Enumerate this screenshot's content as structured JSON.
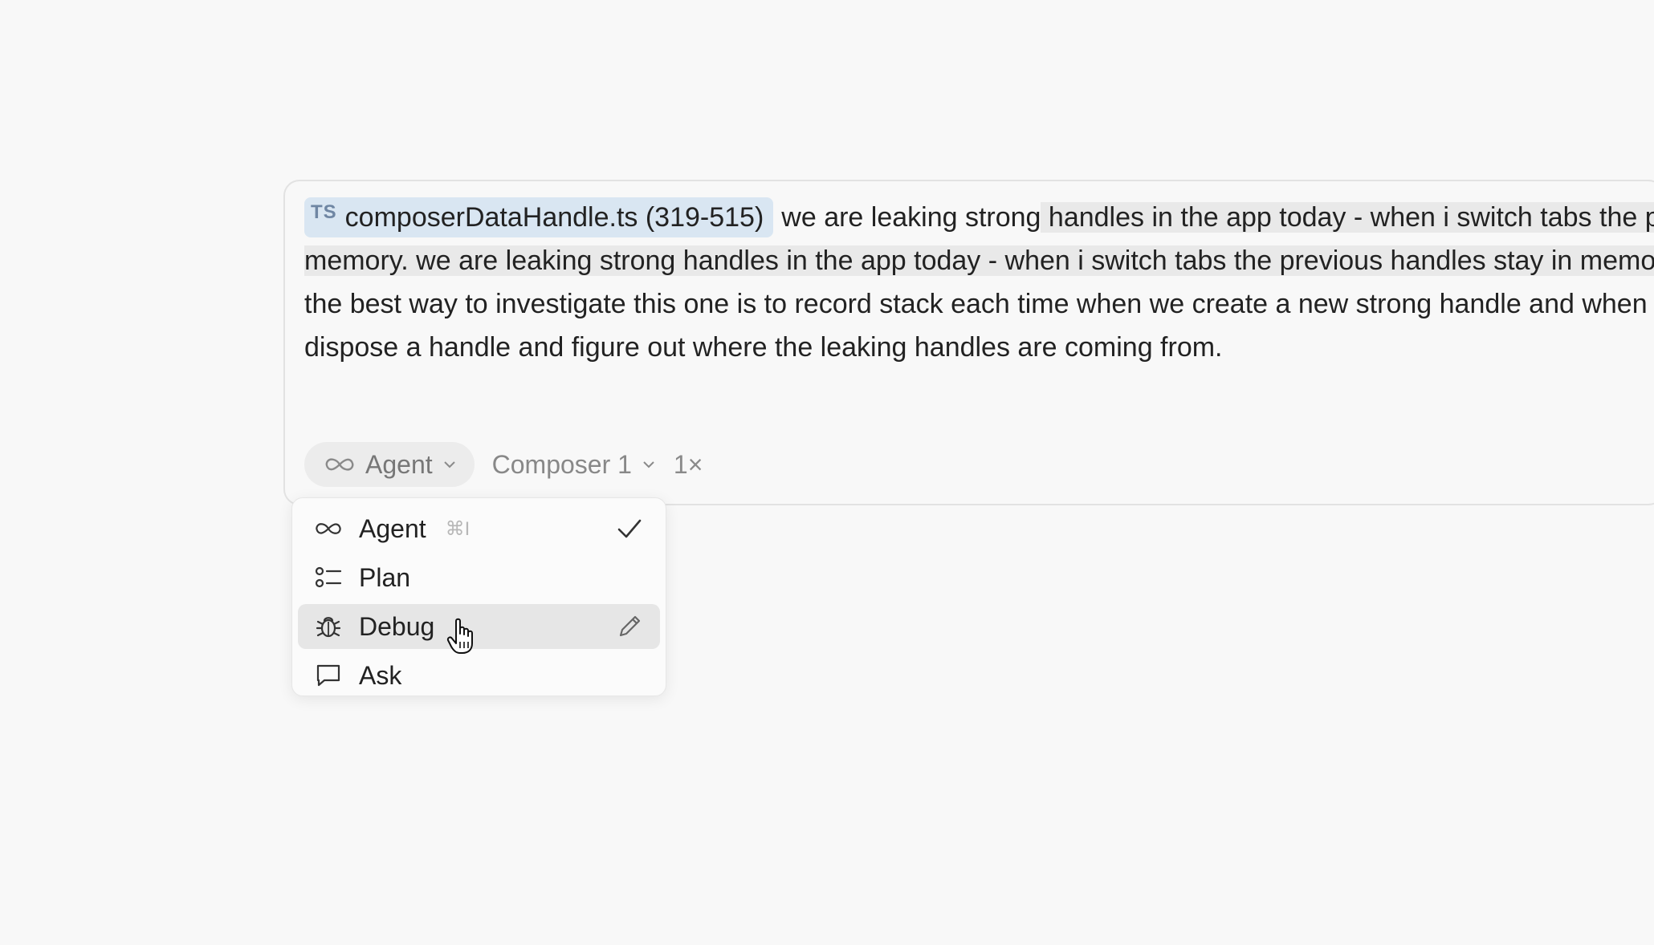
{
  "composer": {
    "file_chip": {
      "lang": "TS",
      "filename": "composerDataHandle.ts (319-515)"
    },
    "line1_pre": "we are leaking strong",
    "line1_hl": " handles in the app today - when i switch tabs the previous handles stay in",
    "line2": "memory. we are leaking strong handles in the app today - when i switch tabs the previous handles stay in memory.",
    "line3": "the best way to investigate this one is to record stack each time when we create a new strong handle and when we",
    "line4": "dispose a handle and figure out where the leaking handles are coming from."
  },
  "toolbar": {
    "mode_label": "Agent",
    "mode_icon": "infinity-icon",
    "model_label": "Composer 1",
    "speed_label": "1×"
  },
  "menu": {
    "items": [
      {
        "label": "Agent",
        "icon": "infinity-icon",
        "shortcut": "⌘I",
        "right_icon": "check-icon"
      },
      {
        "label": "Plan",
        "icon": "list-icon"
      },
      {
        "label": "Debug",
        "icon": "bug-icon",
        "right_icon": "pencil-icon",
        "hovered": true
      },
      {
        "label": "Ask",
        "icon": "chat-bubble-icon"
      }
    ]
  }
}
